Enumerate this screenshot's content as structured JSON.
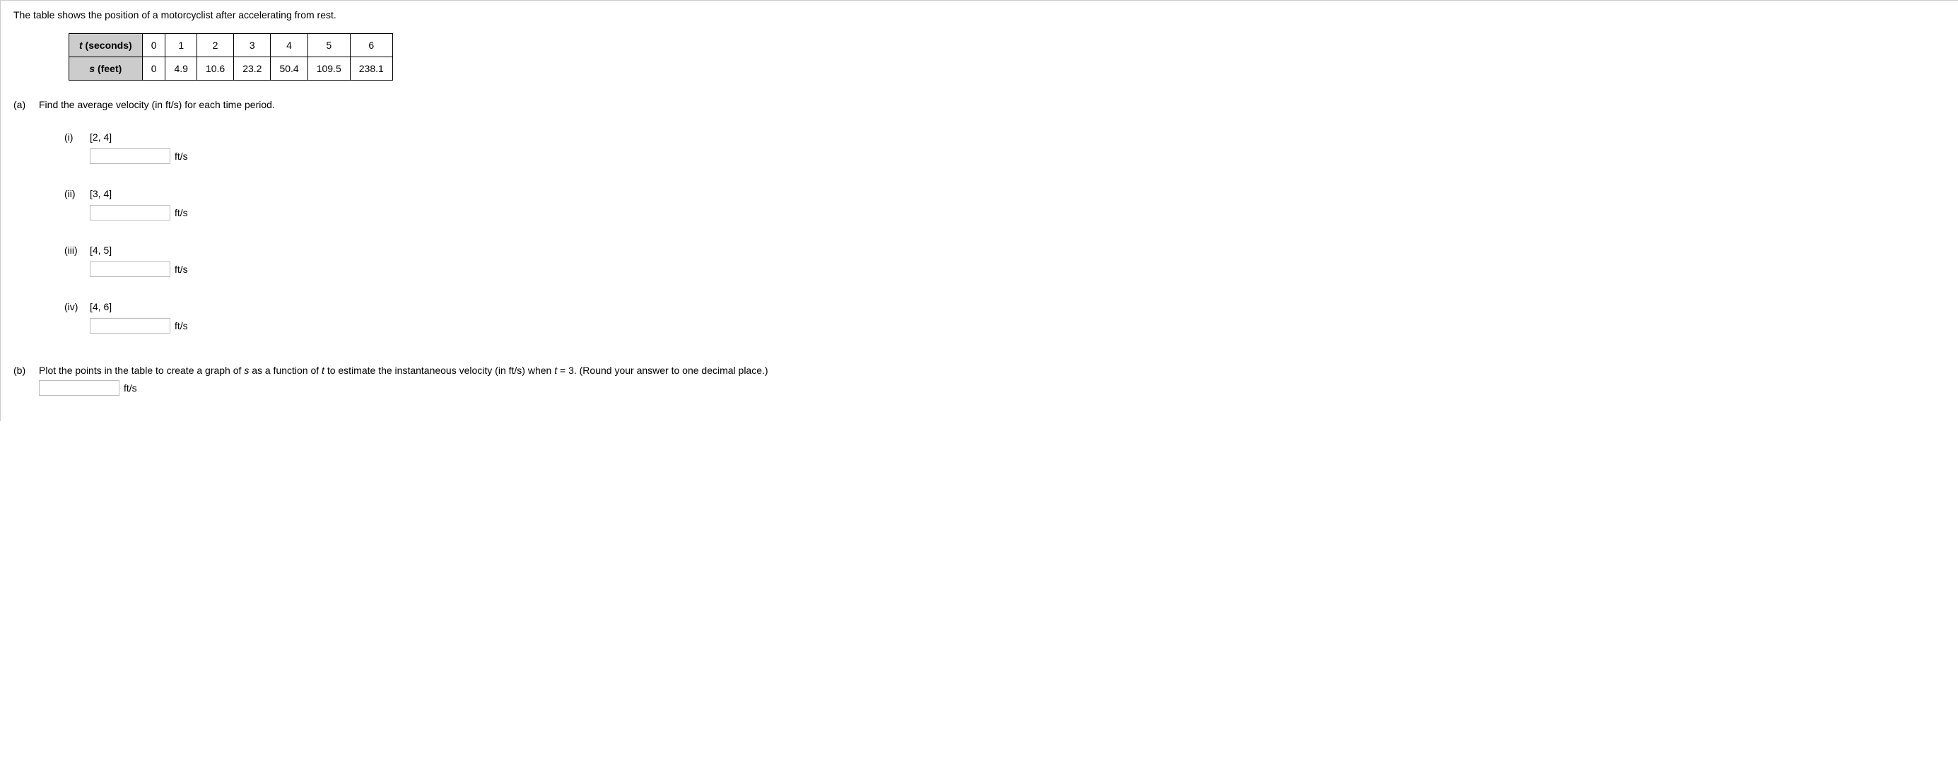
{
  "intro": "The table shows the position of a motorcyclist after accelerating from rest.",
  "table": {
    "row1_header_prefix": "t",
    "row1_header_suffix": " (seconds)",
    "row1": [
      "0",
      "1",
      "2",
      "3",
      "4",
      "5",
      "6"
    ],
    "row2_header_prefix": "s",
    "row2_header_suffix": " (feet)",
    "row2": [
      "0",
      "4.9",
      "10.6",
      "23.2",
      "50.4",
      "109.5",
      "238.1"
    ]
  },
  "part_a": {
    "label": "(a)",
    "prompt": "Find the average velocity (in ft/s) for each time period.",
    "unit": "ft/s",
    "subparts": [
      {
        "label": "(i)",
        "interval": "[2, 4]"
      },
      {
        "label": "(ii)",
        "interval": "[3, 4]"
      },
      {
        "label": "(iii)",
        "interval": "[4, 5]"
      },
      {
        "label": "(iv)",
        "interval": "[4, 6]"
      }
    ]
  },
  "part_b": {
    "label": "(b)",
    "prompt_pre": "Plot the points in the table to create a graph of ",
    "var1": "s",
    "prompt_mid1": " as a function of ",
    "var2": "t",
    "prompt_mid2": " to estimate the instantaneous velocity (in ft/s) when ",
    "eq": "t = 3",
    "prompt_post": ". (Round your answer to one decimal place.)",
    "unit": "ft/s"
  }
}
